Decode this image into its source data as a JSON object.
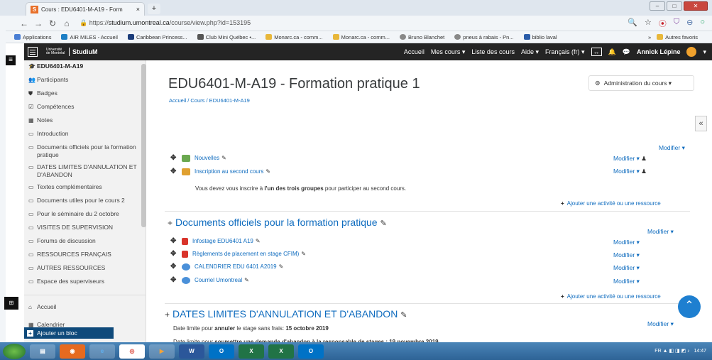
{
  "browser": {
    "tab_title": "Cours : EDU6401-M-A19 - Form",
    "tab_close": "×",
    "new_tab": "+",
    "url_prefix": "https://",
    "url_domain": "studium.umontreal.ca",
    "url_path": "/course/view.php?id=153195",
    "bookmarks": [
      "Applications",
      "AIR MILES - Accueil",
      "Caribbean Princess...",
      "Club Mini Québec •...",
      "Monarc.ca - comm...",
      "Monarc.ca - comm...",
      "Bruno Blanchet",
      "pneus à rabais - Pn...",
      "biblio laval"
    ],
    "bookmarks_more": "»",
    "bookmarks_other": "Autres favoris"
  },
  "navbar": {
    "logo_small": "Université de Montréal",
    "logo_text": "StudiuM",
    "links": [
      "Accueil",
      "Mes cours ▾",
      "Liste des cours",
      "Aide ▾",
      "Français (fr) ▾"
    ],
    "user_name": "Annick Lépine"
  },
  "sidebar": {
    "items": [
      {
        "icon": "cap-icon",
        "glyph": "🎓",
        "label": "EDU6401-M-A19",
        "bold": true
      },
      {
        "icon": "users-icon",
        "glyph": "👥",
        "label": "Participants"
      },
      {
        "icon": "badge-icon",
        "glyph": "⛊",
        "label": "Badges"
      },
      {
        "icon": "check-icon",
        "glyph": "☑",
        "label": "Compétences"
      },
      {
        "icon": "table-icon",
        "glyph": "▦",
        "label": "Notes"
      },
      {
        "icon": "folder-icon",
        "glyph": "▭",
        "label": "Introduction"
      },
      {
        "icon": "folder-icon",
        "glyph": "▭",
        "label": "Documents officiels pour la formation pratique"
      },
      {
        "icon": "folder-icon",
        "glyph": "▭",
        "label": "DATES LIMITES D'ANNULATION ET D'ABANDON"
      },
      {
        "icon": "folder-icon",
        "glyph": "▭",
        "label": "Textes complémentaires"
      },
      {
        "icon": "folder-icon",
        "glyph": "▭",
        "label": "Documents utiles pour le cours 2"
      },
      {
        "icon": "folder-icon",
        "glyph": "▭",
        "label": "Pour le séminaire du 2 octobre"
      },
      {
        "icon": "folder-icon",
        "glyph": "▭",
        "label": "VISITES DE SUPERVISION"
      },
      {
        "icon": "folder-icon",
        "glyph": "▭",
        "label": "Forums de discussion"
      },
      {
        "icon": "folder-icon",
        "glyph": "▭",
        "label": "RESSOURCES FRANÇAIS"
      },
      {
        "icon": "folder-icon",
        "glyph": "▭",
        "label": "AUTRES RESSOURCES"
      },
      {
        "icon": "folder-icon",
        "glyph": "▭",
        "label": "Espace des superviseurs"
      }
    ],
    "home": "Accueil",
    "add_block": "Ajouter un bloc",
    "calendar": "Calendrier"
  },
  "main": {
    "title": "EDU6401-M-A19 - Formation pratique 1",
    "breadcrumb": "Accueil / Cours / EDU6401-M-A19",
    "admin_label": "Administration du cours ▾",
    "modifier": "Modifier ▾",
    "move": "✥",
    "edit_glyph": "✎",
    "add_activity": "Ajouter une activité ou une ressource",
    "intro_activities": [
      {
        "name": "Nouvelles",
        "icon": "forum-icon",
        "color": "#6aa84f"
      },
      {
        "name": "Inscription au second cours",
        "icon": "group-icon",
        "color": "#e0a030"
      }
    ],
    "intro_note_pre": "Vous devez vous inscrire à ",
    "intro_note_bold": "l'un des trois groupes",
    "intro_note_post": " pour participer au second cours.",
    "section2_title": "Documents officiels pour la formation pratique",
    "section2_activities": [
      {
        "name": "Infostage EDU6401 A19",
        "icon": "pdf-icon",
        "color": "#d9342b"
      },
      {
        "name": "Règlements de placement en stage CFIM)",
        "icon": "pdf-icon",
        "color": "#d9342b"
      },
      {
        "name": "CALENDRIER EDU 6401 A2019",
        "icon": "url-icon",
        "color": "#4a90d9"
      },
      {
        "name": "Courriel Umontreal",
        "icon": "url-icon",
        "color": "#4a90d9"
      }
    ],
    "section3_title": "DATES LIMITES D'ANNULATION ET D'ABANDON",
    "deadline1_pre": "Date limite pour ",
    "deadline1_bold1": "annuler",
    "deadline1_mid": " le stage sans frais: ",
    "deadline1_bold2": "15 octobre 2019",
    "deadline2_pre": "Date limite pour ",
    "deadline2_bold": "soumettre une demande d'abandon à la responsable de stages : 19 novembre 2019"
  },
  "taskbar": {
    "apps": [
      "W",
      "O",
      "X",
      "X",
      "O"
    ],
    "tray_lang": "FR",
    "time": "14:47"
  }
}
